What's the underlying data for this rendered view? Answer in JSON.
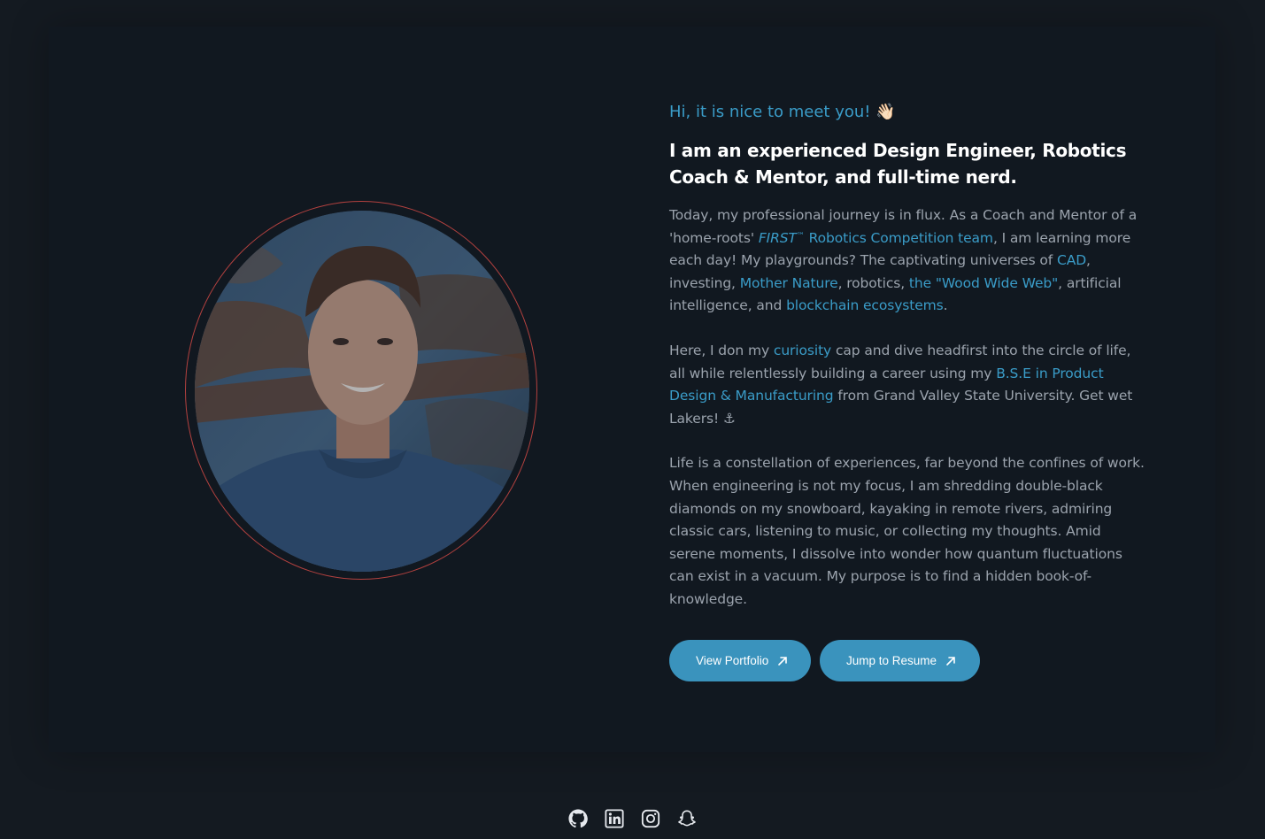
{
  "intro": {
    "greeting": "Hi, it is nice to meet you!",
    "greeting_emoji": "👋🏻",
    "headline": "I am an experienced Design Engineer, Robotics Coach & Mentor, and full-time nerd."
  },
  "paragraph1": {
    "t1": "Today, my professional journey is in flux. As a Coach and Mentor of a 'home-roots' ",
    "first_label": "FIRST",
    "tm": "™",
    "link_team": " Robotics Competition team",
    "t2": ", I am learning more each day! My playgrounds? The captivating universes of ",
    "link_cad": "CAD",
    "t3": ", investing, ",
    "link_nature": "Mother Nature",
    "t4": ", robotics, ",
    "link_wood": "the \"Wood Wide Web\"",
    "t5": ", artificial intelligence, and ",
    "link_blockchain": "blockchain ecosystems",
    "t6": "."
  },
  "paragraph2": {
    "t1": "Here, I don my ",
    "link_curiosity": "curiosity",
    "t2": " cap and dive headfirst into the circle of life, all while relentlessly building a career using my ",
    "link_degree": "B.S.E in Product Design & Manufacturing",
    "t3": " from Grand Valley State University. Get wet Lakers! ⚓"
  },
  "paragraph3": {
    "text": "Life is a constellation of experiences, far beyond the confines of work. When engineering is not my focus, I am shredding double-black diamonds on my snowboard, kayaking in remote rivers, admiring classic cars, listening to music, or collecting my thoughts. Amid serene moments, I dissolve into wonder how quantum fluctuations can exist in a vacuum. My purpose is to find a hidden book-of-knowledge."
  },
  "buttons": {
    "portfolio": "View Portfolio",
    "resume": "Jump to Resume",
    "icon": "arrow-up-right-icon"
  },
  "socials": {
    "items": [
      "github-icon",
      "linkedin-icon",
      "instagram-icon",
      "snapchat-icon"
    ]
  },
  "colors": {
    "accent": "#3a9cc8",
    "button": "#3a93bd",
    "ring": "#b3413f",
    "background": "#141a21"
  }
}
